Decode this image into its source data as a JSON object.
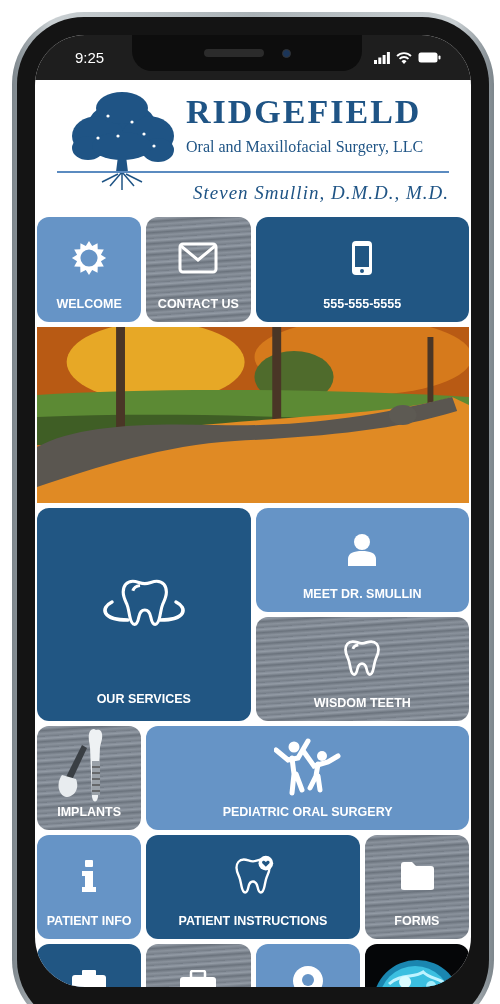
{
  "status_bar": {
    "time": "9:25"
  },
  "header": {
    "title": "RIDGEFIELD",
    "subtitle": "Oral and Maxillofacial Surgery, LLC",
    "doctor": "Steven Smullin, D.M.D., M.D."
  },
  "banner": {
    "kind": "picture"
  },
  "tiles": [
    {
      "label": "WELCOME",
      "kind": "light"
    },
    {
      "label": "CONTACT US",
      "kind": "textured"
    },
    {
      "label": "555-555-5555",
      "kind": "dark"
    },
    {
      "label": "OUR SERVICES",
      "kind": "dark"
    },
    {
      "label": "MEET DR. SMULLIN",
      "kind": "light"
    },
    {
      "label": "WISDOM TEETH",
      "kind": "textured"
    },
    {
      "label": "IMPLANTS",
      "kind": "textured"
    },
    {
      "label": "PEDIATRIC ORAL SURGERY",
      "kind": "light"
    },
    {
      "label": "PATIENT INFO",
      "kind": "light"
    },
    {
      "label": "PATIENT INSTRUCTIONS",
      "kind": "dark"
    },
    {
      "label": "FORMS",
      "kind": "textured"
    },
    {
      "kind": "dark"
    },
    {
      "kind": "textured"
    },
    {
      "kind": "light"
    },
    {
      "kind": "picture"
    }
  ]
}
